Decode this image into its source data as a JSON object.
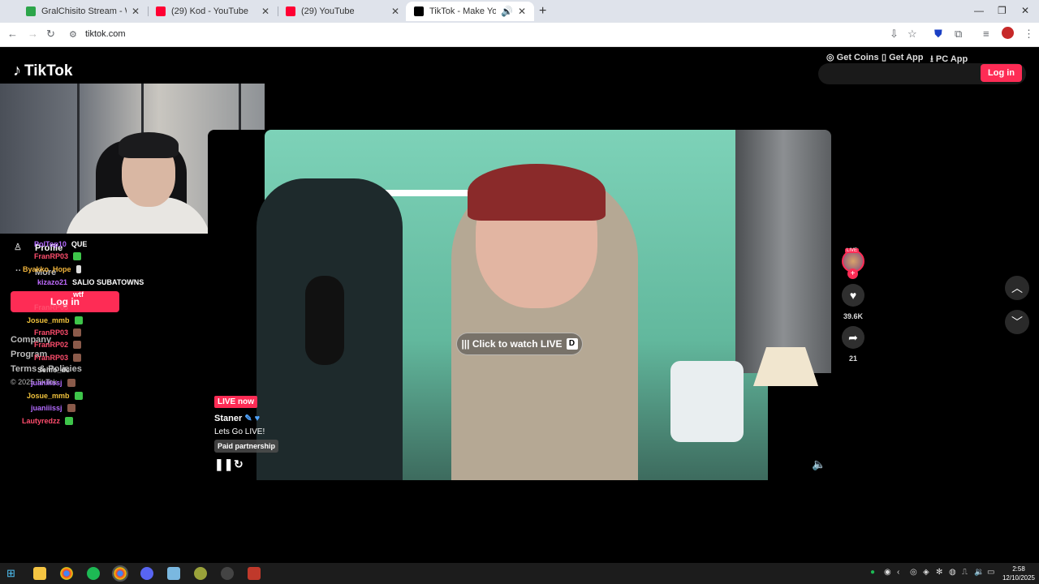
{
  "browser": {
    "tabs": [
      {
        "title": "GralChisito Stream - Watch Live",
        "favicon_color": "#2ca54a"
      },
      {
        "title": "(29) Kod - YouTube",
        "favicon_color": "#ff0033"
      },
      {
        "title": "(29) YouTube",
        "favicon_color": "#ff0033"
      },
      {
        "title": "TikTok - Make Your Day",
        "favicon_color": "#000000"
      }
    ],
    "url": "tiktok.com"
  },
  "header": {
    "logo": "TikTok",
    "get_coins": "Get Coins",
    "get_app": "Get App",
    "pc_app": "PC App",
    "login": "Log in"
  },
  "sidebar": {
    "profile": "Profile",
    "more": "More",
    "login": "Log in",
    "company": "Company",
    "program": "Program",
    "terms": "Terms & Policies",
    "copyright": "© 2025 TikTok"
  },
  "chat": [
    {
      "user": "PolTop10",
      "msg": "QUE",
      "color": "#b36bff"
    },
    {
      "user": "FranRP03",
      "msg": "",
      "color": "#ff4d6d"
    },
    {
      "user": "Byakko_Hope",
      "msg": "",
      "color": "#f0b43c"
    },
    {
      "user": "kizazo21",
      "msg": "SALIO SUBATOWNS",
      "color": "#c06bff"
    },
    {
      "user": "",
      "msg": "wtf",
      "color": "#ff4d6d"
    },
    {
      "user": "FranRP03",
      "msg": "",
      "color": "#ff4d6d"
    },
    {
      "user": "Josue_mmb",
      "msg": "",
      "color": "#f0c23c"
    },
    {
      "user": "FranRP03",
      "msg": "",
      "color": "#ff4d6d"
    },
    {
      "user": "FranRP02",
      "msg": "",
      "color": "#ff4d6d"
    },
    {
      "user": "FranRP03",
      "msg": "",
      "color": "#ff4d6d"
    },
    {
      "user": "Sehio_dc",
      "msg": "",
      "color": "#cccccc"
    },
    {
      "user": "juaniiissj",
      "msg": "",
      "color": "#b36bff"
    },
    {
      "user": "Josue_mmb",
      "msg": "",
      "color": "#f0c23c"
    },
    {
      "user": "juaniiissj",
      "msg": "",
      "color": "#b36bff"
    },
    {
      "user": "Lautyredzz",
      "msg": "",
      "color": "#ff4d6d"
    }
  ],
  "video": {
    "cta": "Click to watch LIVE",
    "cta_key": "D",
    "live_badge": "LIVE now",
    "username": "Staner",
    "description": "Lets Go LIVE!",
    "paid": "Paid partnership"
  },
  "rail": {
    "avatar_badge": "LIVE",
    "likes": "39.6K",
    "shares": "21"
  },
  "taskbar": {
    "time": "2:58",
    "date": "12/10/2025"
  },
  "colors": {
    "brand": "#fe2c55"
  }
}
